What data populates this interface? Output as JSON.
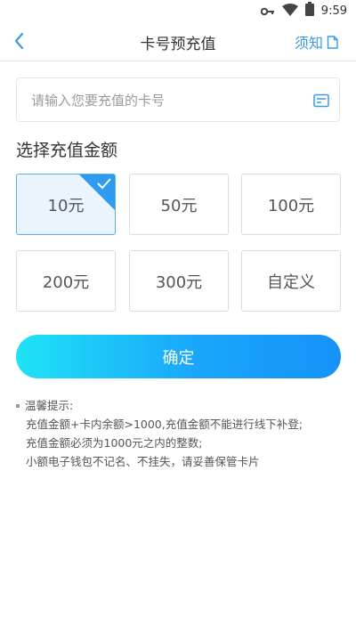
{
  "status_bar": {
    "time": "9:59",
    "icons": [
      "vpn-key-icon",
      "wifi-icon",
      "battery-icon"
    ]
  },
  "nav": {
    "back_icon": "chevron-left-icon",
    "title": "卡号预充值",
    "notice_label": "须知",
    "notice_icon": "document-icon"
  },
  "card_input": {
    "placeholder": "请输入您要充值的卡号",
    "value": "",
    "icon": "card-icon"
  },
  "amount_section": {
    "title": "选择充值金额",
    "options": [
      {
        "label": "10元",
        "selected": true
      },
      {
        "label": "50元",
        "selected": false
      },
      {
        "label": "100元",
        "selected": false
      },
      {
        "label": "200元",
        "selected": false
      },
      {
        "label": "300元",
        "selected": false
      },
      {
        "label": "自定义",
        "selected": false
      }
    ]
  },
  "confirm_button": {
    "label": "确定"
  },
  "tips": {
    "title": "温馨提示:",
    "lines": [
      "充值金额+卡内余额>1000,充值金额不能进行线下补登;",
      "充值金额必须为1000元之内的整数;",
      "小额电子钱包不记名、不挂失，请妥善保管卡片"
    ]
  },
  "colors": {
    "accent": "#2f9bf0",
    "button_gradient_start": "#1ee3f6",
    "button_gradient_end": "#1592f8",
    "selected_bg": "#e9f4fd"
  }
}
